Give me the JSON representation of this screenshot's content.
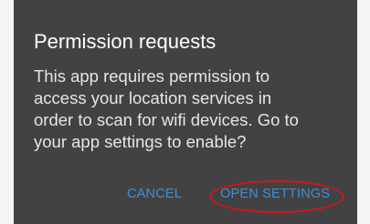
{
  "dialog": {
    "title": "Permission requests",
    "message": "This app requires permission to\naccess your location services in\norder to scan for wifi devices. Go to\nyour app settings to enable?",
    "cancel_label": "CANCEL",
    "open_settings_label": "OPEN SETTINGS"
  },
  "colors": {
    "dialog_background": "#424242",
    "button_text": "#3f8fd6",
    "highlight_ring": "#d5141b"
  }
}
